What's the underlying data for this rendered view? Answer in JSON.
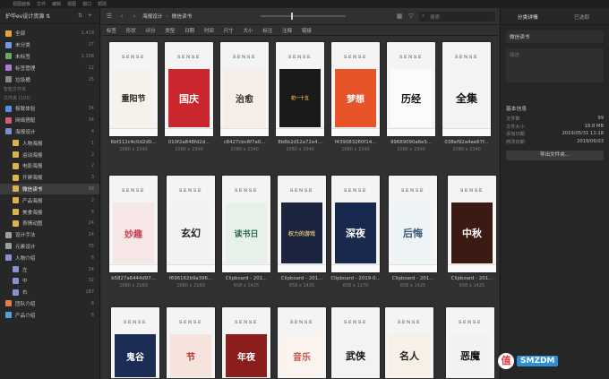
{
  "menubar": [
    "视图面板",
    "文件",
    "编辑",
    "视图",
    "窗口",
    "帮助"
  ],
  "sidebar": {
    "library_title": "护华ev设计资源 ⇅",
    "items": [
      {
        "label": "全部",
        "count": "1,419"
      },
      {
        "label": "未分类",
        "count": "27"
      },
      {
        "label": "未标签",
        "count": "1,158"
      },
      {
        "label": "标签管理",
        "count": "12"
      },
      {
        "label": "垃圾桶",
        "count": "25"
      }
    ],
    "smart_label": "智能文件夹",
    "folder_label": "文件夹 (103)",
    "folders": [
      {
        "label": "极致体验",
        "count": "34"
      },
      {
        "label": "网络搭配",
        "count": "34"
      },
      {
        "label": "海报设计",
        "count": "4"
      },
      {
        "label": "人物海报",
        "count": "1"
      },
      {
        "label": "运动海报",
        "count": "2"
      },
      {
        "label": "电影海报",
        "count": "2"
      },
      {
        "label": "开屏海报",
        "count": "3"
      },
      {
        "label": "微信读书",
        "count": "99"
      },
      {
        "label": "产品海报",
        "count": "2"
      },
      {
        "label": "美食海报",
        "count": "5"
      },
      {
        "label": "表情动图",
        "count": "24"
      },
      {
        "label": "设计手法",
        "count": "24"
      },
      {
        "label": "元素设计",
        "count": "75"
      },
      {
        "label": "人物介绍",
        "count": "6"
      },
      {
        "label": "左",
        "count": "24"
      },
      {
        "label": "中",
        "count": "32"
      },
      {
        "label": "右",
        "count": "187"
      },
      {
        "label": "团队介绍",
        "count": "6"
      },
      {
        "label": "产品介绍",
        "count": "6"
      }
    ]
  },
  "toolbar": {
    "crumb1": "海报设计",
    "crumb2": "微信读书",
    "search_placeholder": "搜索"
  },
  "filters": [
    "标签",
    "形状",
    "评分",
    "类型",
    "日期",
    "时间",
    "尺寸",
    "大小",
    "标注",
    "注释",
    "链接"
  ],
  "cards": [
    {
      "name": "6bf112c4c0d2d0...",
      "dim": "1080 x 2340",
      "art": "重阳节",
      "bg": "#f6f1ea",
      "fg": "#222",
      "size": "9px"
    },
    {
      "name": "010f2a848fd2d...",
      "dim": "1080 x 2340",
      "art": "国庆",
      "bg": "#c9262d",
      "fg": "#fff",
      "size": "11px"
    },
    {
      "name": "c8427cbc6f7a0...",
      "dim": "1080 x 2340",
      "art": "治愈",
      "bg": "#f7ede8",
      "fg": "#333",
      "size": "10px"
    },
    {
      "name": "8b8b2d12a72e4...",
      "dim": "1080 x 2340",
      "art": "初一十五",
      "bg": "#1a1a1a",
      "fg": "#d8a94a",
      "size": "5px"
    },
    {
      "name": "f439083260f14...",
      "dim": "1080 x 2340",
      "art": "梦想",
      "bg": "#e8542a",
      "fg": "#fff",
      "size": "10px"
    },
    {
      "name": "99689090a6e5...",
      "dim": "1080 x 2340",
      "art": "历经",
      "bg": "#fbfbfb",
      "fg": "#111",
      "size": "11px"
    },
    {
      "name": "038ef92a4ae67f...",
      "dim": "1080 x 2340",
      "art": "全集",
      "bg": "#f3f3f3",
      "fg": "#111",
      "size": "12px"
    },
    {
      "name": "b5827a6444d97...",
      "dim": "1080 x 2160",
      "art": "妙趣",
      "bg": "#f7e6e6",
      "fg": "#c4434f",
      "size": "10px"
    },
    {
      "name": "f696162b9a396...",
      "dim": "1080 x 2160",
      "art": "玄幻",
      "bg": "#f2f2f2",
      "fg": "#222",
      "size": "11px"
    },
    {
      "name": "Clipboard - 201...",
      "dim": "658 x 1425",
      "art": "读书日",
      "bg": "#e8f0ea",
      "fg": "#2f6b4f",
      "size": "9px"
    },
    {
      "name": "Clipboard - 201...",
      "dim": "658 x 1425",
      "art": "权力的游戏",
      "bg": "#1b2540",
      "fg": "#d6b96a",
      "size": "6px"
    },
    {
      "name": "Clipboard - 2019-0...",
      "dim": "658 x 1170",
      "art": "深夜",
      "bg": "#18294d",
      "fg": "#fff",
      "size": "11px"
    },
    {
      "name": "Clipboard - 201...",
      "dim": "658 x 1425",
      "art": "后悔",
      "bg": "#eef3f6",
      "fg": "#3a5a7a",
      "size": "11px"
    },
    {
      "name": "Clipboard - 201...",
      "dim": "658 x 1425",
      "art": "中秋",
      "bg": "#3a1a12",
      "fg": "#fff",
      "size": "11px"
    },
    {
      "name": "",
      "dim": "",
      "art": "鬼谷",
      "bg": "#1c2c55",
      "fg": "#fff",
      "size": "10px"
    },
    {
      "name": "",
      "dim": "",
      "art": "节",
      "bg": "#f6e3dc",
      "fg": "#b0332b",
      "size": "10px"
    },
    {
      "name": "",
      "dim": "",
      "art": "年夜",
      "bg": "#8c1d1d",
      "fg": "#fff",
      "size": "10px"
    },
    {
      "name": "",
      "dim": "",
      "art": "音乐",
      "bg": "#fbf4ee",
      "fg": "#c6534a",
      "size": "10px"
    },
    {
      "name": "",
      "dim": "",
      "art": "武侠",
      "bg": "#f3f3f3",
      "fg": "#111",
      "size": "11px"
    },
    {
      "name": "",
      "dim": "",
      "art": "名人",
      "bg": "#f6f0e6",
      "fg": "#222",
      "size": "11px"
    },
    {
      "name": "",
      "dim": "",
      "art": "恶魔",
      "bg": "#f2f2f2",
      "fg": "#111",
      "size": "11px"
    }
  ],
  "sense": "SENSE",
  "right": {
    "tab1": "分类详情",
    "tab2": "已选取",
    "name": "微信读书",
    "note_placeholder": "描述",
    "info_title": "基本信息",
    "rows": [
      {
        "k": "文件数",
        "v": "99"
      },
      {
        "k": "文件大小",
        "v": "16.8 MB"
      },
      {
        "k": "添加日期",
        "v": "2019/05/31 11:18"
      },
      {
        "k": "修改日期",
        "v": "2019/06/03"
      }
    ],
    "button": "导出文件夹..."
  },
  "watermark": {
    "glyph": "值",
    "text": "SMZDM"
  }
}
